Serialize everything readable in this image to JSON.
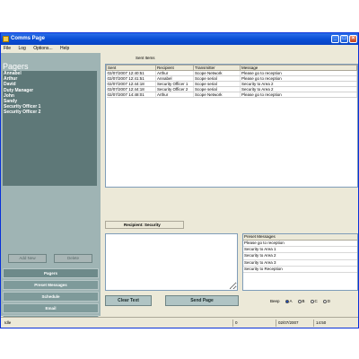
{
  "window": {
    "title": "Comms Page",
    "controls": {
      "minimize": "_",
      "maximize": "□",
      "close": "×"
    }
  },
  "menu": [
    "File",
    "Log",
    "Options...",
    "Help"
  ],
  "sidebar": {
    "header": "Pagers",
    "pagers": [
      "Annabel",
      "Arthur",
      "David",
      "Duty Manager",
      "John",
      "Sandy",
      "Security Officer 1",
      "Security Officer 2"
    ],
    "add_new_label": "Add New",
    "delete_label": "Delete",
    "nav": [
      "Pagers",
      "Preset Messages",
      "Schedule",
      "Email",
      "Pager Groups"
    ]
  },
  "sent_items": {
    "label": "Sent Items",
    "columns": [
      "Sent",
      "Recipient",
      "Transmitter",
      "Message"
    ],
    "rows": [
      [
        "02/07/2007 12:40:51",
        "Arthur",
        "Scope Network",
        "Please go to reception"
      ],
      [
        "02/07/2007 12:41:51",
        "Annabel",
        "Scope serial",
        "Please go to reception"
      ],
      [
        "02/07/2007 12:44:18",
        "Security Officer 1",
        "Scope serial",
        "Security to Area 2"
      ],
      [
        "02/07/2007 12:44:18",
        "Security Officer 2",
        "Scope serial",
        "Security to Area 2"
      ],
      [
        "02/07/2007 14:48:01",
        "Arthur",
        "Scope Network",
        "Please go to reception"
      ]
    ]
  },
  "recipient": {
    "label": "Recipient: Security"
  },
  "message": {
    "value": ""
  },
  "preset_messages": {
    "header": "Preset Messages",
    "items": [
      "Please go to reception",
      "Security to Area 1",
      "Security to Area 2",
      "Security to Area 3",
      "Security to Reception"
    ]
  },
  "actions": {
    "clear_label": "Clear Text",
    "send_label": "Send Page"
  },
  "beep": {
    "label": "Beep",
    "options": [
      "A",
      "B",
      "C",
      "D"
    ],
    "selected": "A"
  },
  "status": {
    "state": "Idle",
    "count": "0",
    "date": "02/07/2007",
    "time": "14:50"
  },
  "colors": {
    "titlebar": "#0a4fd6",
    "sidebar": "#9fb4b4",
    "pager_list": "#5e7878"
  }
}
